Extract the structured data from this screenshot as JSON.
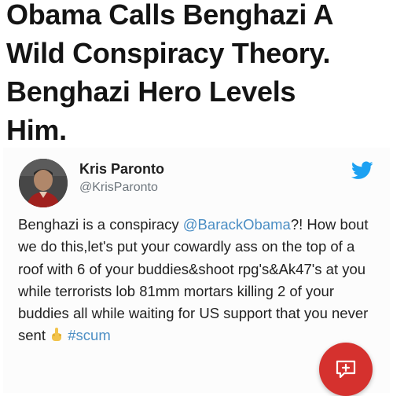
{
  "headline": {
    "lines": [
      "Obama Calls Benghazi A",
      "Wild Conspiracy Theory.",
      "Benghazi Hero Levels",
      "Him."
    ]
  },
  "tweet": {
    "display_name": "Kris Paronto",
    "handle": "@KrisParonto",
    "text_before_mention": "Benghazi is a conspiracy ",
    "mention": "@BarackObama",
    "text_after_mention": "?! How bout we do this,let's put your cowardly ass on the top of a roof with 6 of your buddies&shoot rpg's&Ak47's at you while terrorists lob 81mm mortars killing 2 of your buddies all while waiting for US support that you never sent ",
    "hashtag": "#scum"
  },
  "icons": {
    "brand": "twitter-bird-icon",
    "emoji": "middle-finger-emoji-icon",
    "fab": "comment-plus-icon"
  },
  "colors": {
    "twitter_blue": "#1da1f2",
    "link": "#4b8ec4",
    "fab_red": "#d5312e"
  }
}
